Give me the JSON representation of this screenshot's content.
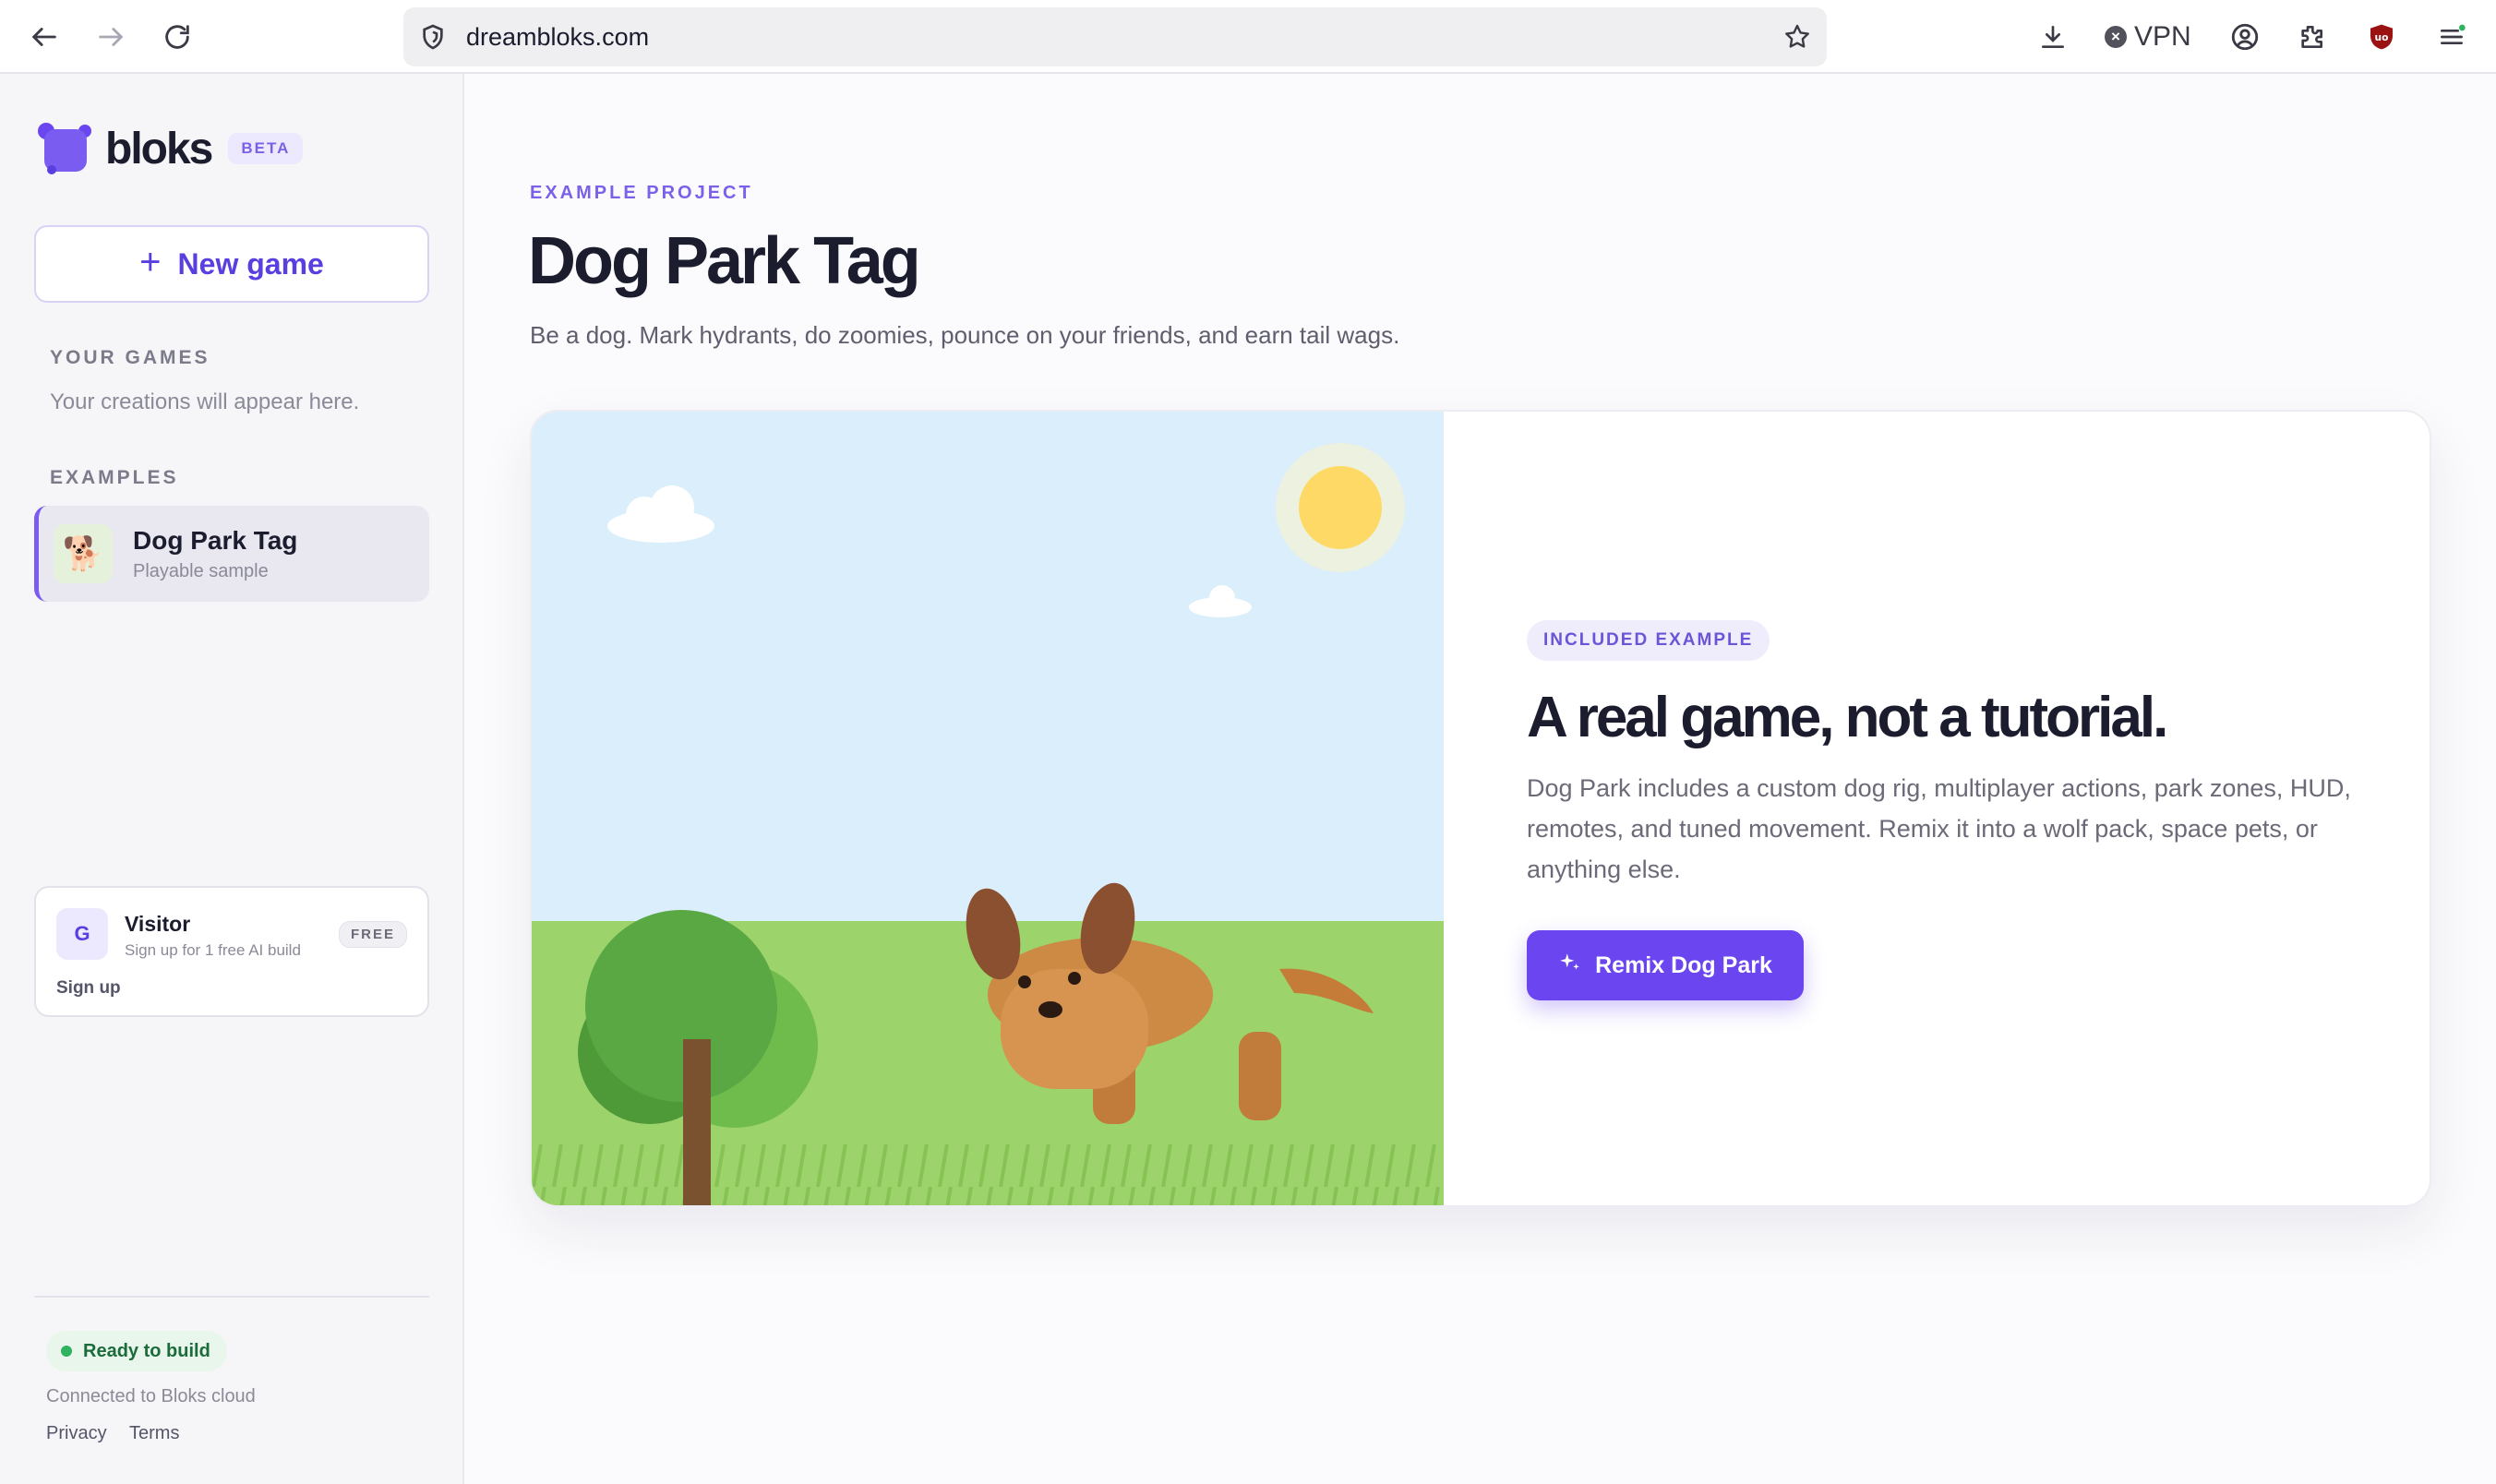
{
  "browser": {
    "url": "dreambloks.com",
    "vpn_label": "VPN"
  },
  "sidebar": {
    "logo_text": "bloks",
    "beta_label": "BETA",
    "new_game_label": "New game",
    "your_games_label": "YOUR GAMES",
    "your_games_empty": "Your creations will appear here.",
    "examples_label": "EXAMPLES",
    "examples": [
      {
        "title": "Dog Park Tag",
        "subtitle": "Playable sample",
        "icon": "dog-emoji"
      }
    ],
    "visitor": {
      "avatar_letter": "G",
      "name": "Visitor",
      "subtitle": "Sign up for 1 free AI build",
      "plan_badge": "FREE",
      "signup_label": "Sign up"
    },
    "status": {
      "label": "Ready to build",
      "connected_text": "Connected to Bloks cloud"
    },
    "footer_links": [
      "Privacy",
      "Terms"
    ]
  },
  "main": {
    "eyebrow": "EXAMPLE PROJECT",
    "title": "Dog Park Tag",
    "description": "Be a dog. Mark hydrants, do zoomies, pounce on your friends, and earn tail wags.",
    "hero": {
      "badge": "INCLUDED EXAMPLE",
      "heading": "A real game, not a tutorial.",
      "description": "Dog Park includes a custom dog rig, multiplayer actions, park zones, HUD, remotes, and tuned movement. Remix it into a wolf pack, space pets, or anything else.",
      "button_label": "Remix Dog Park"
    }
  },
  "colors": {
    "accent": "#6a45f0",
    "sky": "#dbeefb",
    "grass": "#9cd36a",
    "sun": "#ffd966",
    "status_green": "#2fb35f"
  }
}
